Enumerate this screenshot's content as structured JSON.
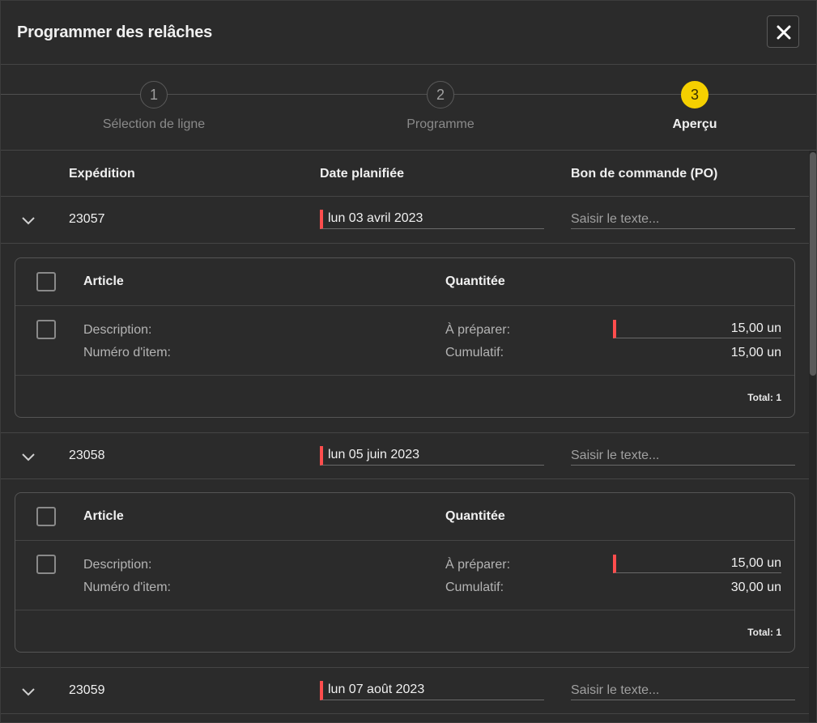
{
  "dialog": {
    "title": "Programmer des relâches"
  },
  "stepper": {
    "steps": [
      {
        "number": "1",
        "label": "Sélection de ligne",
        "active": false
      },
      {
        "number": "2",
        "label": "Programme",
        "active": false
      },
      {
        "number": "3",
        "label": "Aperçu",
        "active": true
      }
    ],
    "active_color": "#f5d000"
  },
  "table": {
    "headers": {
      "shipment": "Expédition",
      "planned_date": "Date planifiée",
      "purchase_order": "Bon de commande (PO)"
    },
    "shipments": [
      {
        "id": "23057",
        "date": "lun 03 avril 2023",
        "po_placeholder": "Saisir le texte...",
        "po_value": "",
        "expanded": true,
        "card": {
          "header_article": "Article",
          "header_quantity": "Quantitée",
          "description_label": "Description:",
          "item_number_label": "Numéro d'item:",
          "to_prepare_label": "À préparer:",
          "to_prepare_value": "15,00 un",
          "cumulative_label": "Cumulatif:",
          "cumulative_value": "15,00 un",
          "total": "Total: 1"
        }
      },
      {
        "id": "23058",
        "date": "lun 05 juin 2023",
        "po_placeholder": "Saisir le texte...",
        "po_value": "",
        "expanded": true,
        "card": {
          "header_article": "Article",
          "header_quantity": "Quantitée",
          "description_label": "Description:",
          "item_number_label": "Numéro d'item:",
          "to_prepare_label": "À préparer:",
          "to_prepare_value": "15,00 un",
          "cumulative_label": "Cumulatif:",
          "cumulative_value": "30,00 un",
          "total": "Total: 1"
        }
      },
      {
        "id": "23059",
        "date": "lun 07 août 2023",
        "po_placeholder": "Saisir le texte...",
        "po_value": "",
        "expanded": false
      }
    ]
  },
  "icons": {
    "close": "close-icon",
    "expand": "chevron-down-icon"
  },
  "colors": {
    "background": "#2b2b2b",
    "required_marker": "#ff4d4d",
    "active_step": "#f5d000"
  }
}
